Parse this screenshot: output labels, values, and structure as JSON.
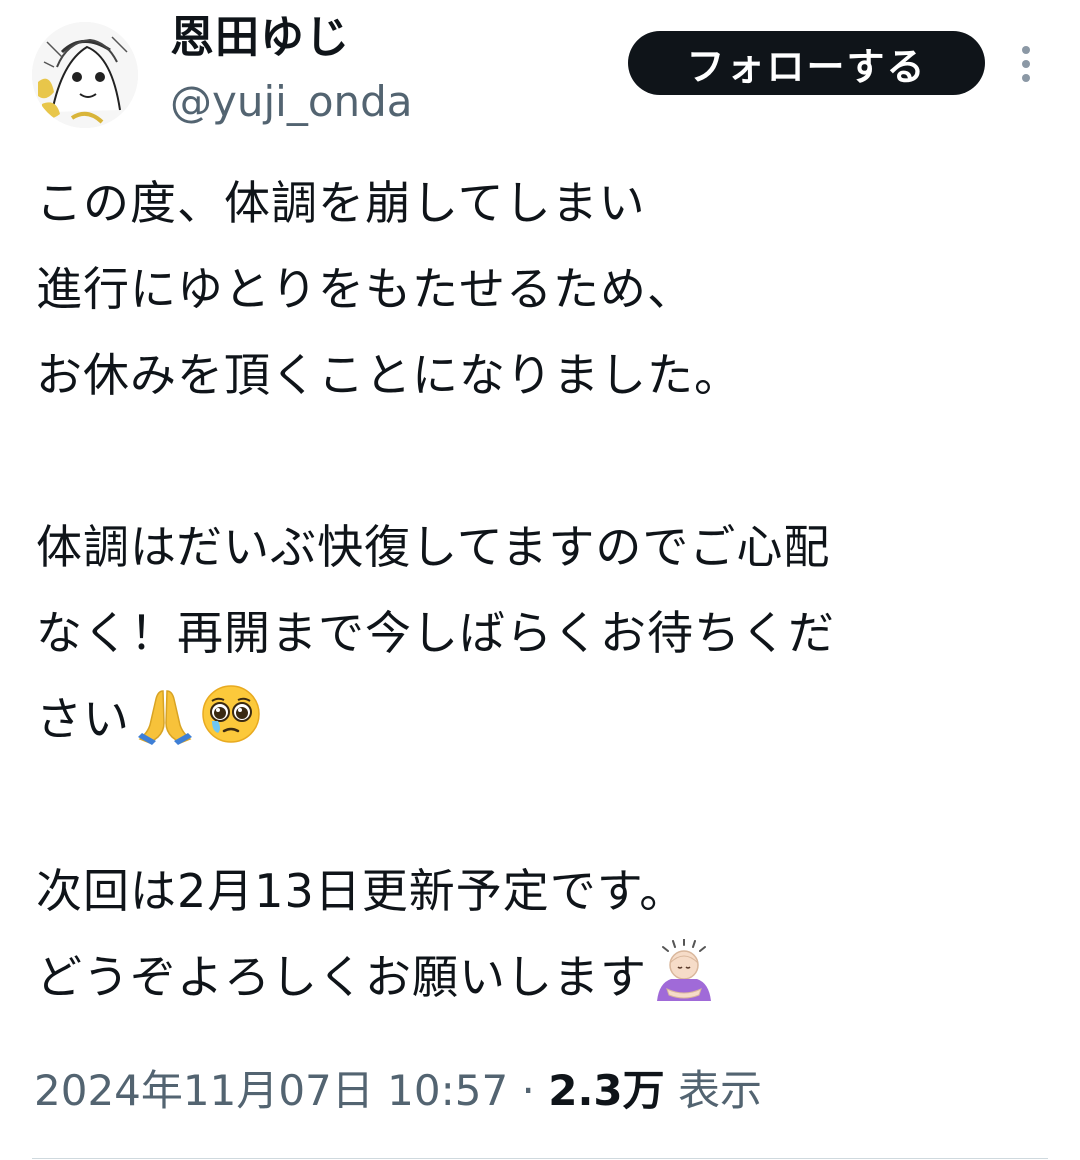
{
  "author": {
    "display_name": "恩田ゆじ",
    "handle": "@yuji_onda"
  },
  "actions": {
    "follow_label": "フォローする",
    "more_icon": "more-vertical-icon"
  },
  "tweet": {
    "lines": [
      "この度、体調を崩してしまい",
      "進行にゆとりをもたせるため、",
      "お休みを頂くことになりました。",
      "",
      "体調はだいぶ快復してますのでご心配",
      "なく！再開まで今しばらくお待ちくだ",
      "さい",
      "",
      "次回は2月13日更新予定です。",
      "どうぞよろしくお願いします"
    ],
    "emojis": {
      "line_7": [
        "folded-hands-emoji",
        "pleading-face-emoji"
      ],
      "line_10": [
        "person-bowing-emoji"
      ]
    }
  },
  "meta": {
    "timestamp": "2024年11月07日 10:57",
    "separator": " · ",
    "views_count": "2.3万",
    "views_label": "表示"
  },
  "colors": {
    "text": "#0f1419",
    "secondary_text": "#536471",
    "button_bg": "#0f1419",
    "button_text": "#ffffff",
    "divider": "#cfd9de"
  }
}
